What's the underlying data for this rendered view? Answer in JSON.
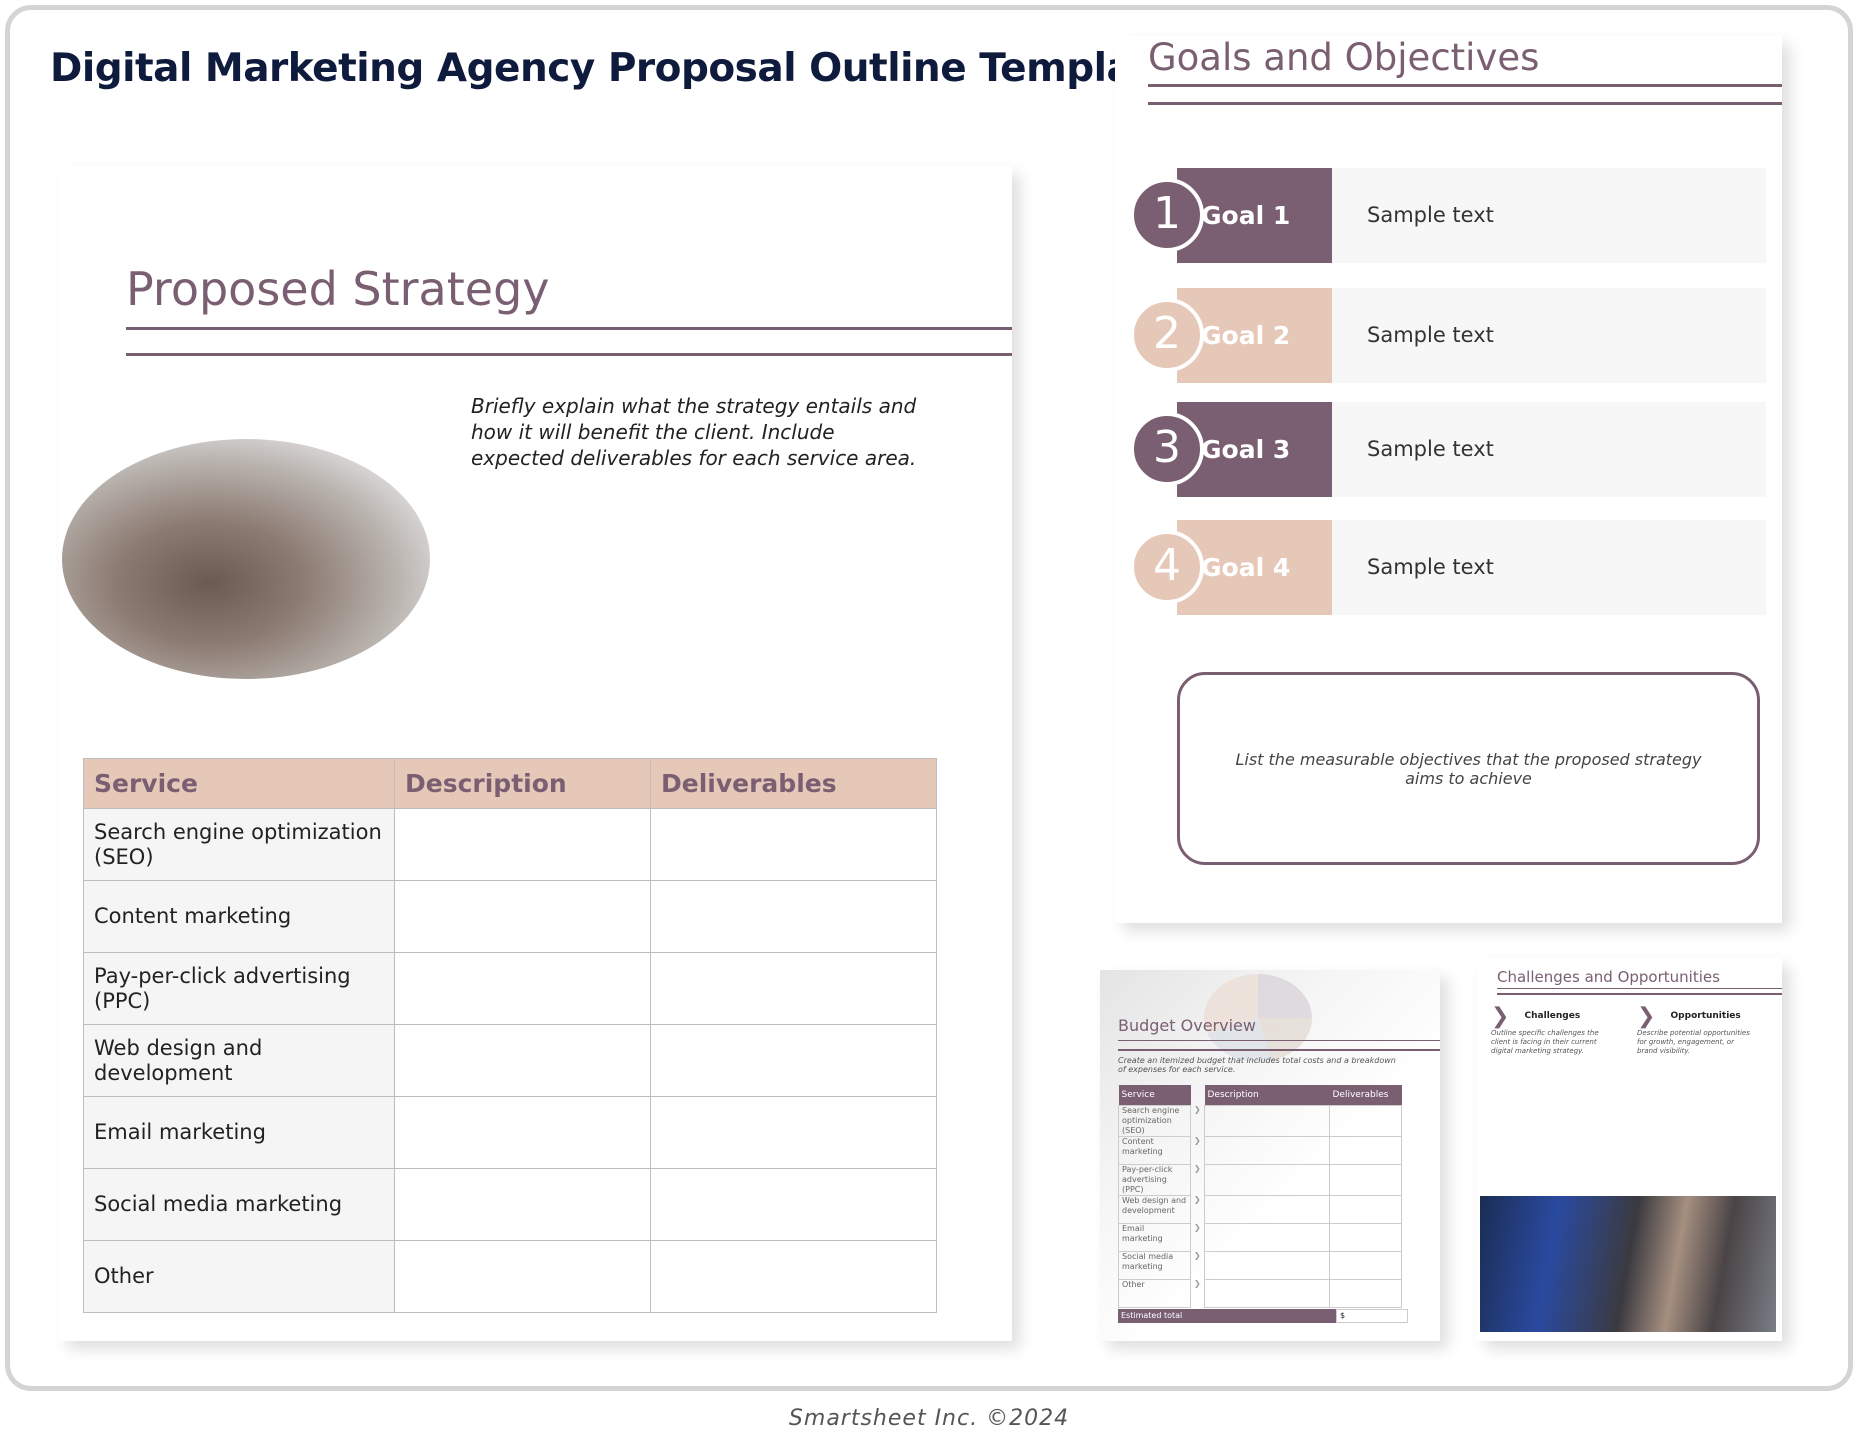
{
  "title": "Digital Marketing Agency Proposal Outline Template",
  "footer": "Smartsheet Inc. ©2024",
  "strategy": {
    "heading": "Proposed Strategy",
    "description": "Briefly explain what the strategy entails and how it will benefit the client. Include expected deliverables for each service area.",
    "table": {
      "headers": [
        "Service",
        "Description",
        "Deliverables"
      ],
      "rows": [
        "Search engine optimization (SEO)",
        "Content marketing",
        "Pay-per-click advertising (PPC)",
        "Web design and development",
        "Email marketing",
        "Social media marketing",
        "Other"
      ]
    }
  },
  "goals": {
    "heading": "Goals and Objectives",
    "items": [
      {
        "number": "1",
        "label": "Goal 1",
        "text": "Sample text"
      },
      {
        "number": "2",
        "label": "Goal 2",
        "text": "Sample text"
      },
      {
        "number": "3",
        "label": "Goal 3",
        "text": "Sample text"
      },
      {
        "number": "4",
        "label": "Goal 4",
        "text": "Sample text"
      }
    ],
    "objectives": "List the measurable objectives that the proposed strategy aims to achieve"
  },
  "budget": {
    "heading": "Budget Overview",
    "description": "Create an itemized budget that includes total costs and a breakdown of expenses for each service.",
    "headers": [
      "Service",
      "Description",
      "Deliverables"
    ],
    "rows": [
      "Search engine optimization (SEO)",
      "Content marketing",
      "Pay-per-click advertising (PPC)",
      "Web design and development",
      "Email marketing",
      "Social media marketing",
      "Other"
    ],
    "total_label": "Estimated total",
    "total_value": "$"
  },
  "challenges": {
    "heading": "Challenges and Opportunities",
    "items": [
      {
        "title": "Challenges",
        "text": "Outline specific challenges the client is facing in their current digital marketing strategy."
      },
      {
        "title": "Opportunities",
        "text": "Describe potential opportunities for growth, engagement, or brand visibility."
      }
    ]
  },
  "colors": {
    "accent_dark": "#7a5f72",
    "accent_light": "#e6c8b9",
    "title": "#0f1b3d"
  }
}
